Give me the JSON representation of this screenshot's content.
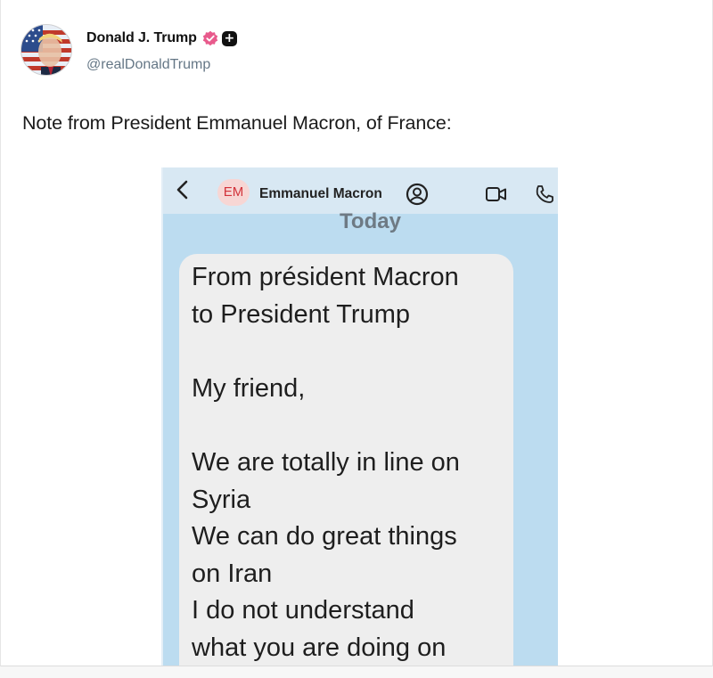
{
  "post": {
    "author_name": "Donald J. Trump",
    "handle": "@realDonaldTrump",
    "badges": [
      "verified-badge",
      "plus-badge"
    ],
    "text": "Note from President Emmanuel Macron, of France:"
  },
  "screenshot": {
    "contact_initials": "EM",
    "contact_name": "Emmanuel Macron",
    "date_divider": "Today",
    "icons": [
      "back-chevron-icon",
      "contact-profile-icon",
      "video-call-icon",
      "phone-call-icon"
    ],
    "message_lines": [
      "From président Macron",
      "to President Trump",
      "",
      "My friend,",
      "",
      "We are totally in line on",
      "Syria",
      "We can do great things",
      "on Iran",
      "I do not understand",
      "what you are doing on"
    ]
  },
  "colors": {
    "phone_background": "#bcdcf0",
    "phone_header": "#d8e8f3",
    "bubble": "#eeeeee",
    "verified_pink": "#e85a8c",
    "handle_gray": "#657786"
  }
}
